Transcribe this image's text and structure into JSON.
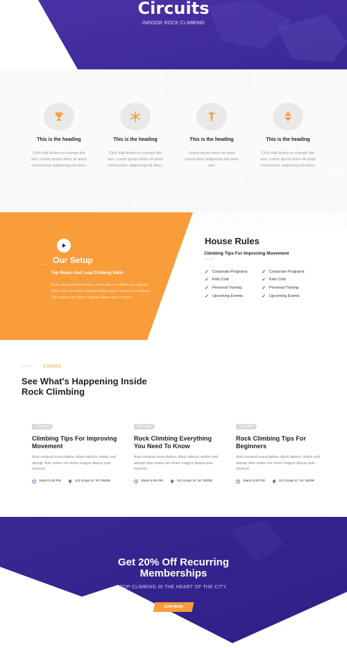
{
  "hero": {
    "title": "Circuits",
    "subtitle": "INDOOR ROCK CLIMBING"
  },
  "features": [
    {
      "icon": "trophy-icon",
      "heading": "This is the heading",
      "body": "Click edit button to change this text. Lorem ipsum dolor sit amet consectetur adipiscing elit dolor."
    },
    {
      "icon": "snowflake-icon",
      "heading": "This is the heading",
      "body": "Click edit button to change this text. Lorem ipsum dolor sit amet consectetur adipiscing elit dolor."
    },
    {
      "icon": "climber-icon",
      "heading": "This is the heading",
      "body": "Lorem ipsum dolor sit amet consectetur adipiscing elit dolor sed."
    },
    {
      "icon": "arrows-updown-icon",
      "heading": "This is the heading",
      "body": "Click edit button to change this text. Lorem ipsum dolor sit amet consectetur adipiscing elit dolor."
    }
  ],
  "setup": {
    "title": "Our Setup",
    "dots": ".......",
    "subtitle": "Top Ropes And Lead Climbing Walls",
    "body": "Auis nostrud exercitation ullam laboris nisitm sed aliquip duis aute ure dolor magna aliqua quis nostrud sed aliquip duis autes ure dolor magna aliqua quis nostrud."
  },
  "house_rules": {
    "title": "House Rules",
    "subtitle": "Climbing Tips For Improving Movement",
    "dots": ".......",
    "left": [
      "Corporate Programs",
      "Kids Club",
      "Personal Traning",
      "Upcoming Events"
    ],
    "right": [
      "Corporate Programs",
      "Kids Club",
      "Personal Traning",
      "Upcoming Events"
    ]
  },
  "events": {
    "label_dots": ".......",
    "label": "EVENTS",
    "title": "See What's Happening Inside Rock Climbing",
    "items": [
      {
        "date": "15 JUNE",
        "title": "Climbing Tips For Improving Movement",
        "desc": "Auis nostrud exercitation ullam laboris nisitm sed aliquip duis autes ure dolor magna aliqua quis nostrud.",
        "time": "Starts 5.00 PM",
        "location": "121 Kings St. NY 26038"
      },
      {
        "date": "18 JUNE",
        "title": "Rock Climbing Everything You Need To Know",
        "desc": "Auis nostrud exercitation ullam laboris nisitm sed aliquip duis autes ure dolor magna aliqua quis nostrud.",
        "time": "Starts 5.00 PM",
        "location": "121 Kings St. NY 26038"
      },
      {
        "date": "24 JUNE",
        "title": "Rock Climbing Tips For Beginners",
        "desc": "Auis nostrud exercitation ullam laboris nisitm sed aliquip duis autes ure dolor magna aliqua quis nostrud.",
        "time": "Starts 5.00 PM",
        "location": "121 Kings St. NY 26038"
      }
    ]
  },
  "cta": {
    "title": "Get 20% Off Recurring Memberships",
    "subtitle": "TOP CLIMBING IN THE HEART OF THE CITY.",
    "button": "JOIN NOW"
  },
  "colors": {
    "purple": "#3c2a98",
    "orange": "#f99c3a",
    "check": "#5b3bb5"
  }
}
